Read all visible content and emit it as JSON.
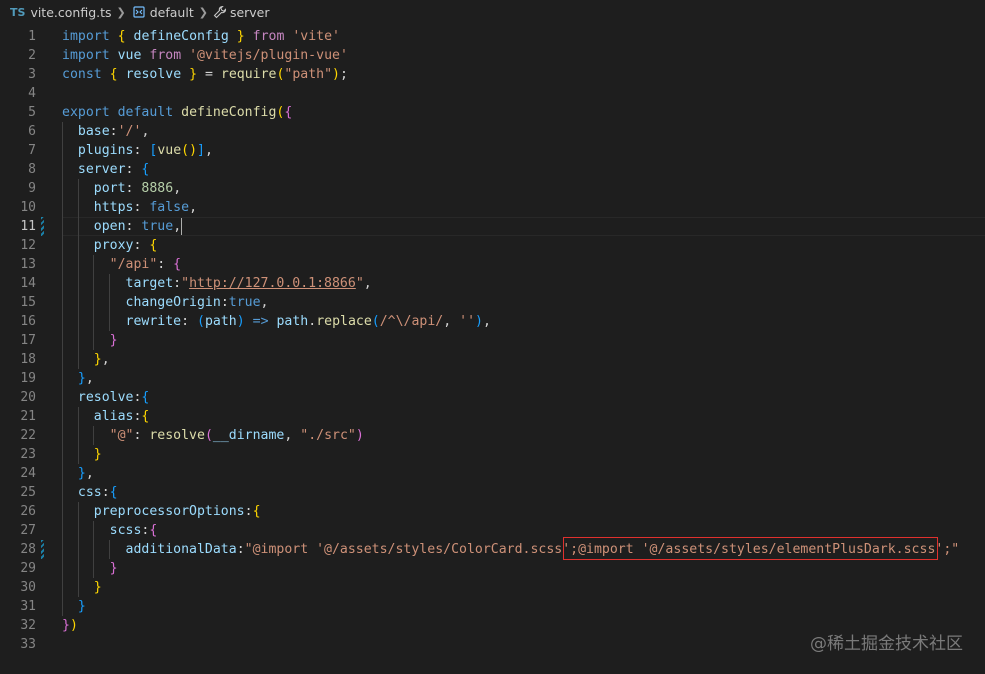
{
  "breadcrumb": {
    "lang_badge": "TS",
    "file": "vite.config.ts",
    "symbol": "default",
    "member": "server"
  },
  "editor": {
    "line_numbers": [
      "1",
      "2",
      "3",
      "4",
      "5",
      "6",
      "7",
      "8",
      "9",
      "10",
      "11",
      "12",
      "13",
      "14",
      "15",
      "16",
      "17",
      "18",
      "19",
      "20",
      "21",
      "22",
      "23",
      "24",
      "25",
      "26",
      "27",
      "28",
      "29",
      "30",
      "31",
      "32",
      "33"
    ],
    "active_line": 11,
    "modified_lines": [
      11,
      28
    ],
    "lines": [
      [
        [
          "kw",
          "import"
        ],
        [
          "pun",
          " "
        ],
        [
          "br1",
          "{"
        ],
        [
          "pun",
          " "
        ],
        [
          "var",
          "defineConfig"
        ],
        [
          "pun",
          " "
        ],
        [
          "br1",
          "}"
        ],
        [
          "pun",
          " "
        ],
        [
          "ctl",
          "from"
        ],
        [
          "pun",
          " "
        ],
        [
          "str",
          "'vite'"
        ]
      ],
      [
        [
          "kw",
          "import"
        ],
        [
          "pun",
          " "
        ],
        [
          "var",
          "vue"
        ],
        [
          "pun",
          " "
        ],
        [
          "ctl",
          "from"
        ],
        [
          "pun",
          " "
        ],
        [
          "str",
          "'@vitejs/plugin-vue'"
        ]
      ],
      [
        [
          "kw",
          "const"
        ],
        [
          "pun",
          " "
        ],
        [
          "br1",
          "{"
        ],
        [
          "pun",
          " "
        ],
        [
          "var",
          "resolve"
        ],
        [
          "pun",
          " "
        ],
        [
          "br1",
          "}"
        ],
        [
          "pun",
          " = "
        ],
        [
          "fn",
          "require"
        ],
        [
          "br1",
          "("
        ],
        [
          "str",
          "\"path\""
        ],
        [
          "br1",
          ")"
        ],
        [
          "pun",
          ";"
        ]
      ],
      [],
      [
        [
          "kw",
          "export"
        ],
        [
          "pun",
          " "
        ],
        [
          "kw",
          "default"
        ],
        [
          "pun",
          " "
        ],
        [
          "fn",
          "defineConfig"
        ],
        [
          "br1",
          "("
        ],
        [
          "br2",
          "{"
        ]
      ],
      [
        [
          "pun",
          "  "
        ],
        [
          "var",
          "base"
        ],
        [
          "pun",
          ":"
        ],
        [
          "str",
          "'/'"
        ],
        [
          "pun",
          ","
        ]
      ],
      [
        [
          "pun",
          "  "
        ],
        [
          "var",
          "plugins"
        ],
        [
          "pun",
          ": "
        ],
        [
          "br3",
          "["
        ],
        [
          "fn",
          "vue"
        ],
        [
          "br1",
          "()"
        ],
        [
          "br3",
          "]"
        ],
        [
          "pun",
          ","
        ]
      ],
      [
        [
          "pun",
          "  "
        ],
        [
          "var",
          "server"
        ],
        [
          "pun",
          ": "
        ],
        [
          "br3",
          "{"
        ]
      ],
      [
        [
          "pun",
          "    "
        ],
        [
          "var",
          "port"
        ],
        [
          "pun",
          ": "
        ],
        [
          "num",
          "8886"
        ],
        [
          "pun",
          ","
        ]
      ],
      [
        [
          "pun",
          "    "
        ],
        [
          "var",
          "https"
        ],
        [
          "pun",
          ": "
        ],
        [
          "kw",
          "false"
        ],
        [
          "pun",
          ","
        ]
      ],
      [
        [
          "pun",
          "    "
        ],
        [
          "var",
          "open"
        ],
        [
          "pun",
          ": "
        ],
        [
          "kw",
          "true"
        ],
        [
          "pun",
          ","
        ]
      ],
      [
        [
          "pun",
          "    "
        ],
        [
          "var",
          "proxy"
        ],
        [
          "pun",
          ": "
        ],
        [
          "br1",
          "{"
        ]
      ],
      [
        [
          "pun",
          "      "
        ],
        [
          "str",
          "\"/api\""
        ],
        [
          "pun",
          ": "
        ],
        [
          "br2",
          "{"
        ]
      ],
      [
        [
          "pun",
          "        "
        ],
        [
          "var",
          "target"
        ],
        [
          "pun",
          ":"
        ],
        [
          "str",
          "\""
        ],
        [
          "str url",
          "http://127.0.0.1:8866"
        ],
        [
          "str",
          "\""
        ],
        [
          "pun",
          ","
        ]
      ],
      [
        [
          "pun",
          "        "
        ],
        [
          "var",
          "changeOrigin"
        ],
        [
          "pun",
          ":"
        ],
        [
          "kw",
          "true"
        ],
        [
          "pun",
          ","
        ]
      ],
      [
        [
          "pun",
          "        "
        ],
        [
          "var",
          "rewrite"
        ],
        [
          "pun",
          ": "
        ],
        [
          "br3",
          "("
        ],
        [
          "var",
          "path"
        ],
        [
          "br3",
          ")"
        ],
        [
          "pun",
          " "
        ],
        [
          "kw",
          "=>"
        ],
        [
          "pun",
          " "
        ],
        [
          "var",
          "path"
        ],
        [
          "pun",
          "."
        ],
        [
          "fn",
          "replace"
        ],
        [
          "br3",
          "("
        ],
        [
          "str",
          "/^\\/api/"
        ],
        [
          "pun",
          ", "
        ],
        [
          "str",
          "''"
        ],
        [
          "br3",
          ")"
        ],
        [
          "pun",
          ","
        ]
      ],
      [
        [
          "pun",
          "      "
        ],
        [
          "br2",
          "}"
        ]
      ],
      [
        [
          "pun",
          "    "
        ],
        [
          "br1",
          "}"
        ],
        [
          "pun",
          ","
        ]
      ],
      [
        [
          "pun",
          "  "
        ],
        [
          "br3",
          "}"
        ],
        [
          "pun",
          ","
        ]
      ],
      [
        [
          "pun",
          "  "
        ],
        [
          "var",
          "resolve"
        ],
        [
          "pun",
          ":"
        ],
        [
          "br3",
          "{"
        ]
      ],
      [
        [
          "pun",
          "    "
        ],
        [
          "var",
          "alias"
        ],
        [
          "pun",
          ":"
        ],
        [
          "br1",
          "{"
        ]
      ],
      [
        [
          "pun",
          "      "
        ],
        [
          "str",
          "\"@\""
        ],
        [
          "pun",
          ": "
        ],
        [
          "fn",
          "resolve"
        ],
        [
          "br2",
          "("
        ],
        [
          "var",
          "__dirname"
        ],
        [
          "pun",
          ", "
        ],
        [
          "str",
          "\"./src\""
        ],
        [
          "br2",
          ")"
        ]
      ],
      [
        [
          "pun",
          "    "
        ],
        [
          "br1",
          "}"
        ]
      ],
      [
        [
          "pun",
          "  "
        ],
        [
          "br3",
          "}"
        ],
        [
          "pun",
          ","
        ]
      ],
      [
        [
          "pun",
          "  "
        ],
        [
          "var",
          "css"
        ],
        [
          "pun",
          ":"
        ],
        [
          "br3",
          "{"
        ]
      ],
      [
        [
          "pun",
          "    "
        ],
        [
          "var",
          "preprocessorOptions"
        ],
        [
          "pun",
          ":"
        ],
        [
          "br1",
          "{"
        ]
      ],
      [
        [
          "pun",
          "      "
        ],
        [
          "var",
          "scss"
        ],
        [
          "pun",
          ":"
        ],
        [
          "br2",
          "{"
        ]
      ],
      [
        [
          "pun",
          "        "
        ],
        [
          "var",
          "additionalData"
        ],
        [
          "pun",
          ":"
        ],
        [
          "str",
          "\"@import '@/assets/styles/ColorCard.scss';@import '@/assets/styles/elementPlusDark.scss';\""
        ]
      ],
      [
        [
          "pun",
          "      "
        ],
        [
          "br2",
          "}"
        ]
      ],
      [
        [
          "pun",
          "    "
        ],
        [
          "br1",
          "}"
        ]
      ],
      [
        [
          "pun",
          "  "
        ],
        [
          "br3",
          "}"
        ]
      ],
      [
        [
          "br2",
          "}"
        ],
        [
          "br1",
          ")"
        ]
      ],
      []
    ]
  },
  "watermark": "@稀土掘金技术社区"
}
